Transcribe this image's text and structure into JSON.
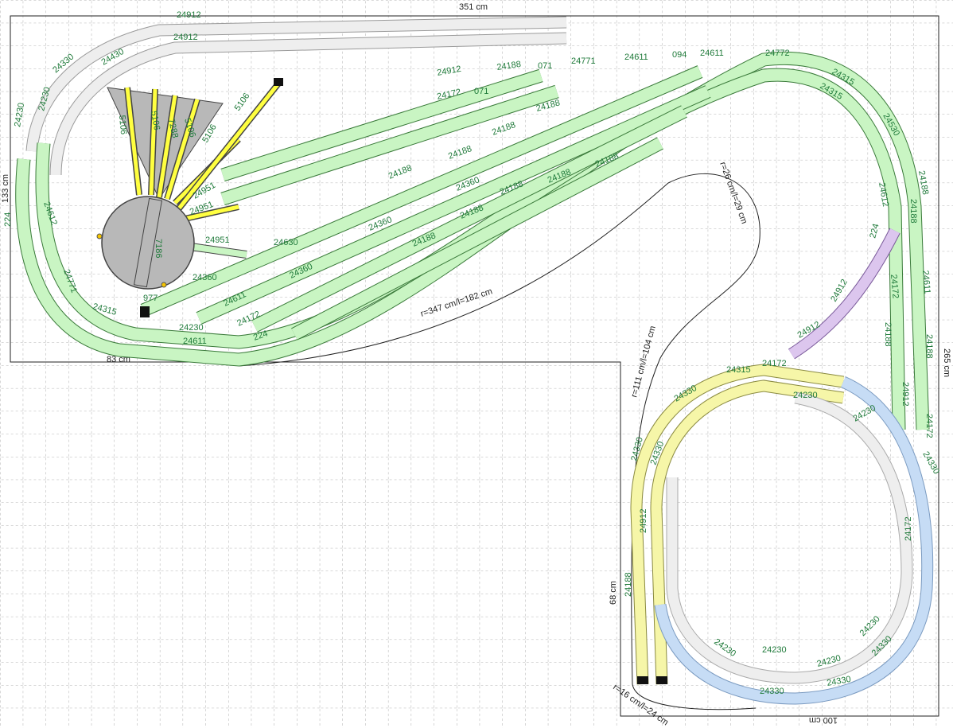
{
  "dimensions": {
    "top_width": "351 cm",
    "left_height": "133 cm",
    "right_height": "265 cm",
    "bottom_width": "100 cm",
    "bottom_left": "83 cm",
    "module_height": "68 cm"
  },
  "curve_notes": {
    "big_arc": "r=347 cm/l=182 cm",
    "mid_arc": "r=111 cm/l=104 cm",
    "top_loop": "r=26 cm/l=29 cm",
    "bottom_arc": "r=16 cm/l=24 cm"
  },
  "turntable": {
    "part": "7186",
    "stalls": [
      "5106",
      "5106",
      "7288",
      "5106",
      "5106",
      "5106",
      "5106",
      "5106"
    ]
  },
  "track_labels": {
    "top_siding": [
      "24912",
      "24912",
      "24330",
      "24430",
      "24230",
      "24230"
    ],
    "main_curve": [
      "24771",
      "24611",
      "094",
      "24611",
      "24772",
      "24315",
      "24315",
      "24530",
      "24188",
      "24612",
      "224",
      "24611",
      "24172",
      "24188",
      "24912",
      "24172",
      "24188"
    ],
    "yard": [
      "24912",
      "24188",
      "071",
      "071",
      "24188",
      "24188",
      "24172",
      "24188",
      "24360",
      "24188",
      "24188",
      "24188",
      "24360",
      "24188",
      "24188",
      "24188"
    ],
    "lower": [
      "24230",
      "24611",
      "24172",
      "224",
      "24360",
      "24360",
      "24951",
      "24951",
      "24951",
      "24630",
      "24611",
      "24315",
      "24771",
      "24612",
      "224",
      "24912",
      "977"
    ],
    "loop": [
      "24330",
      "24330",
      "24330",
      "24315",
      "24172",
      "24230",
      "24230",
      "24330",
      "24330",
      "24230",
      "24230",
      "24330",
      "24230",
      "24230",
      "24912",
      "24912",
      "24188",
      "24330",
      "24172",
      "24188"
    ]
  },
  "colors": {
    "green_track": "#c9f5c3",
    "green_edge": "#3a7a3a",
    "yellow_track": "#f6f6a8",
    "blue_track": "#c6dcf5",
    "violet_track": "#dcc6ee",
    "grey_track": "#eeeeee",
    "label": "#1f7a3a"
  }
}
